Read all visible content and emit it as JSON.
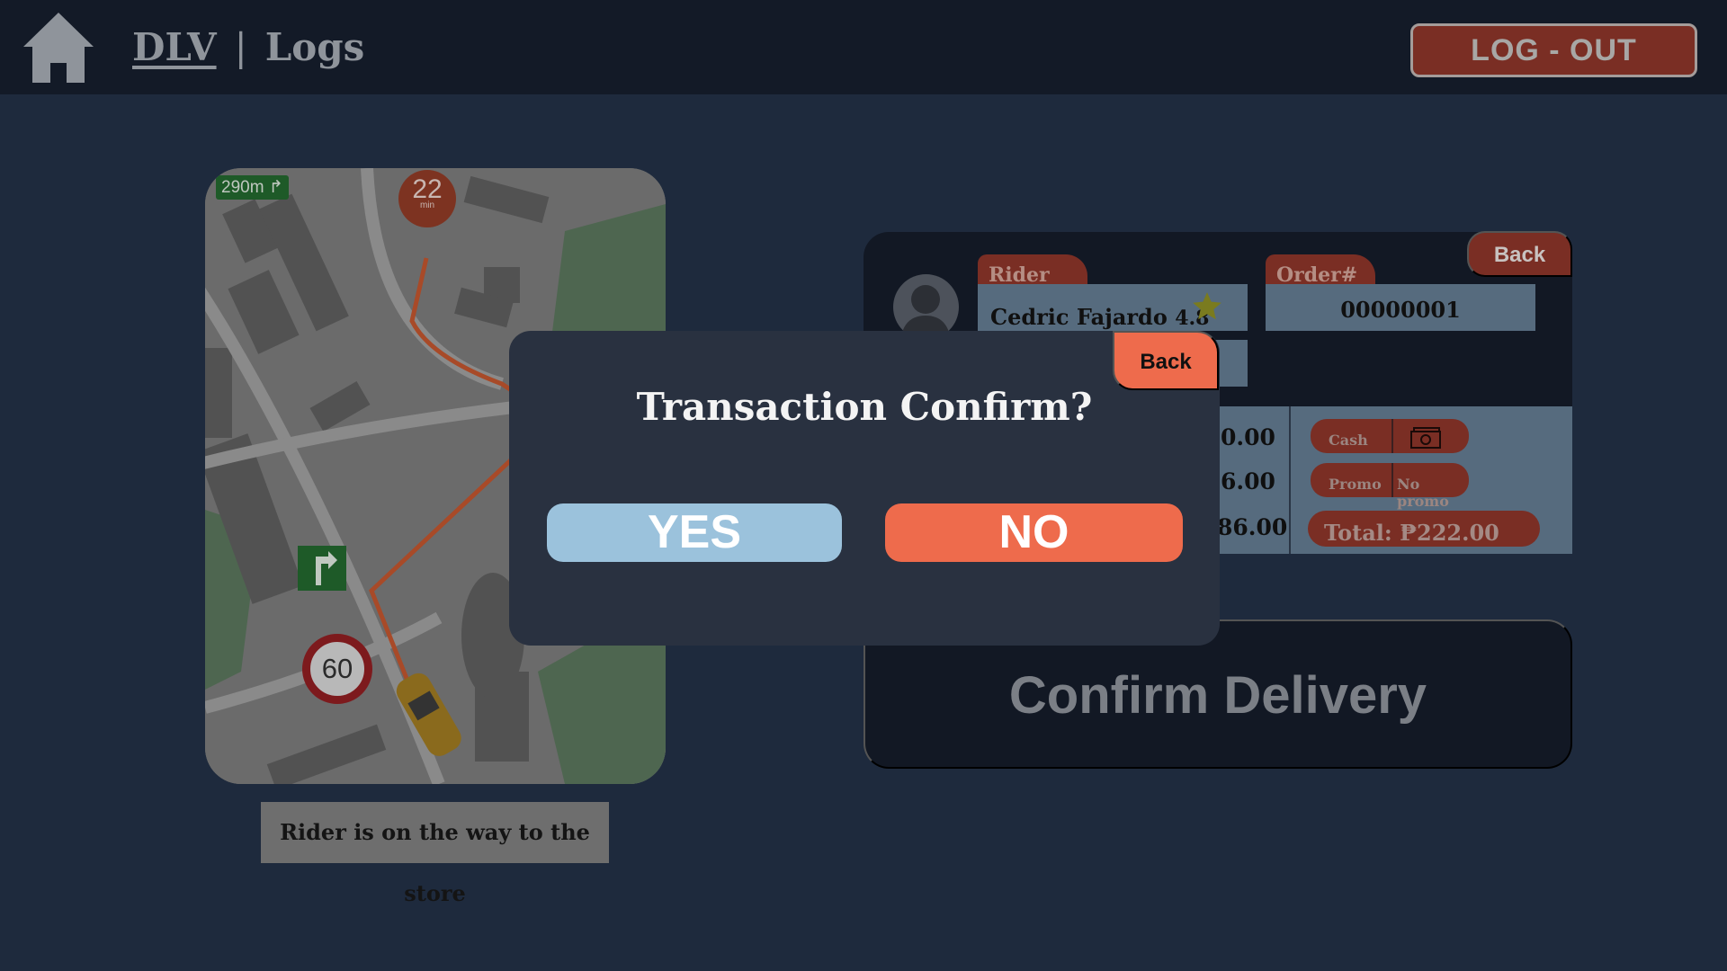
{
  "header": {
    "brand": "DLV",
    "separator": "|",
    "page": "Logs",
    "logout_label": "LOG - OUT"
  },
  "map": {
    "distance": "290m",
    "eta_value": "22",
    "eta_unit": "min",
    "speed_limit": "60"
  },
  "status_text": "Rider is on the way to the store",
  "order": {
    "back_label": "Back",
    "rider_tab": "Rider",
    "rider_name": "Cedric Fajardo",
    "rider_rating": "4.8",
    "order_tab": "Order#",
    "order_number": "00000001",
    "amounts": [
      "0.00",
      "6.00",
      "86.00"
    ],
    "payment_label": "Cash",
    "promo_label": "Promo",
    "promo_value": "No promo",
    "total": "Total: ₱222.00"
  },
  "confirm_delivery_label": "Confirm Delivery",
  "modal": {
    "back_label": "Back",
    "title": "Transaction Confirm?",
    "yes_label": "YES",
    "no_label": "NO"
  }
}
